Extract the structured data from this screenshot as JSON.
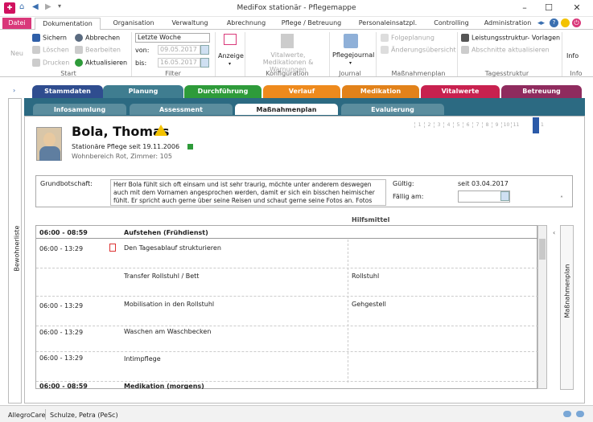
{
  "window": {
    "title": "MediFox stationär - Pflegemappe",
    "min": "–",
    "max": "☐",
    "close": "✕"
  },
  "ribbon_tabs": {
    "file": "Datei",
    "items": [
      "Dokumentation",
      "Organisation",
      "Verwaltung",
      "Abrechnung",
      "Pflege / Betreuung",
      "Personaleinsatzpl.",
      "Controlling",
      "Administration"
    ]
  },
  "ribbon": {
    "start": {
      "new": "Neu",
      "save": "Sichern",
      "delete": "Löschen",
      "print": "Drucken",
      "cancel": "Abbrechen",
      "edit": "Bearbeiten",
      "update": "Aktualisieren",
      "label": "Start"
    },
    "filter": {
      "period_value": "Letzte Woche",
      "from_label": "von:",
      "from_value": "09.05.2017",
      "to_label": "bis:",
      "to_value": "16.05.2017",
      "label": "Filter"
    },
    "display": "Anzeige",
    "config": {
      "btn": "Vitalwerte, Medikationen & Warnungen",
      "label": "Konfiguration"
    },
    "journal": {
      "btn": "Pflegejournal",
      "label": "Journal"
    },
    "plan": {
      "follow": "Folgeplanung",
      "changes": "Änderungsübersicht",
      "label": "Maßnahmenplan"
    },
    "day": {
      "struct": "Leistungsstruktur- Vorlagen",
      "sections": "Abschnitte aktualisieren",
      "label": "Tagesstruktur"
    },
    "info": {
      "btn": "Info",
      "label": "Info"
    }
  },
  "category_tabs": [
    {
      "label": "Stammdaten",
      "color": "#2f4d8f"
    },
    {
      "label": "Planung",
      "color": "#3f7d90"
    },
    {
      "label": "Durchführung",
      "color": "#2e9b3a"
    },
    {
      "label": "Verlauf",
      "color": "#ee8a1d"
    },
    {
      "label": "Medikation",
      "color": "#e2821a"
    },
    {
      "label": "Vitalwerte",
      "color": "#c8214f"
    },
    {
      "label": "Betreuung",
      "color": "#8f2b5e"
    }
  ],
  "sub_tabs": [
    "Infosammlung",
    "Assessment",
    "Maßnahmenplan",
    "Evaluierung"
  ],
  "sidebar": {
    "residents": "Bewohnerliste",
    "measures": "Maßnahmenplan"
  },
  "patient": {
    "name": "Bola, Thomas",
    "care": "Stationäre Pflege  seit 19.11.2006",
    "location": "Wohnbereich Rot, Zimmer: 105"
  },
  "pager": [
    "1",
    "2",
    "3",
    "4",
    "5",
    "6",
    "7",
    "8",
    "9",
    "10",
    "11",
    "",
    "1"
  ],
  "basic": {
    "label": "Grundbotschaft:",
    "text": "Herr Bola fühlt sich oft einsam und ist sehr traurig, möchte unter anderem deswegen auch mit dem Vornamen angesprochen werden, damit er sich ein bisschen heimischer fühlt. Er spricht auch gerne über seine Reisen und schaut gerne seine Fotos an. Fotos und entspr...",
    "valid_label": "Gültig:",
    "valid_value": "seit 03.04.2017",
    "due_label": "Fällig am:"
  },
  "grid": {
    "aids_header": "Hilfsmittel",
    "rows": [
      {
        "time": "06:00 - 08:59",
        "task": "Aufstehen (Frühdienst)",
        "aid": "",
        "bold": true
      },
      {
        "time": "06:00 - 13:29",
        "task": "Den Tagesablauf strukturieren",
        "aid": "",
        "bold": false
      },
      {
        "time": "",
        "task": "Transfer Rollstuhl / Bett",
        "aid": "Rollstuhl",
        "bold": false
      },
      {
        "time": "06:00 - 13:29",
        "task": "Mobilisation in den Rollstuhl",
        "aid": "Gehgestell",
        "bold": false
      },
      {
        "time": "06:00 - 13:29",
        "task": "Waschen am Waschbecken",
        "aid": "",
        "bold": false
      },
      {
        "time": "06:00 - 13:29",
        "task": "Intimpflege",
        "aid": "",
        "bold": false
      },
      {
        "time": "06:00 - 08:59",
        "task": "Medikation (morgens)",
        "aid": "",
        "bold": true
      }
    ]
  },
  "status": {
    "company": "AllegroCare",
    "user": "Schulze, Petra (PeSc)"
  }
}
